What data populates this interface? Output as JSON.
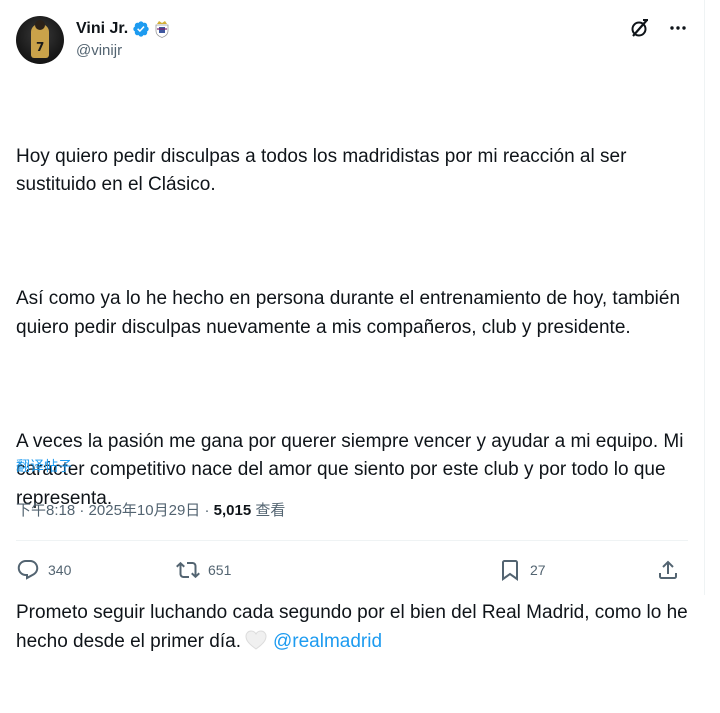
{
  "author": {
    "display_name": "Vini Jr.",
    "handle": "@vinijr",
    "verified_color": "#1d9bf0",
    "avatar_icon": "avatar-image",
    "club_badge_icon": "real-madrid-badge-icon"
  },
  "tweet": {
    "paragraphs": [
      "Hoy quiero pedir disculpas a todos los madridistas por mi reacción al ser sustituido en el Clásico.",
      "Así como ya lo he hecho en persona durante el entrenamiento de hoy, también quiero pedir disculpas nuevamente a mis compañeros, club y presidente.",
      "A veces la pasión me gana por querer siempre vencer y ayudar a mi equipo. Mi carácter competitivo nace del amor que siento por este club y por todo lo que representa."
    ],
    "last_paragraph": "Prometo seguir luchando cada segundo por el bien del Real Madrid, como lo he hecho desde el primer día.",
    "emoji": "white-heart",
    "mention": "@realmadrid",
    "translate_label": "翻译帖子",
    "time": "下午8:18",
    "separator": "·",
    "date": "2025年10月29日",
    "views_count": "5,015",
    "views_label": "查看"
  },
  "actions": {
    "replies": "340",
    "reposts": "651",
    "bookmarks": "27"
  },
  "colors": {
    "accent": "#1d9bf0",
    "text": "#0f1419",
    "secondary": "#536471",
    "border": "#eff3f4"
  }
}
